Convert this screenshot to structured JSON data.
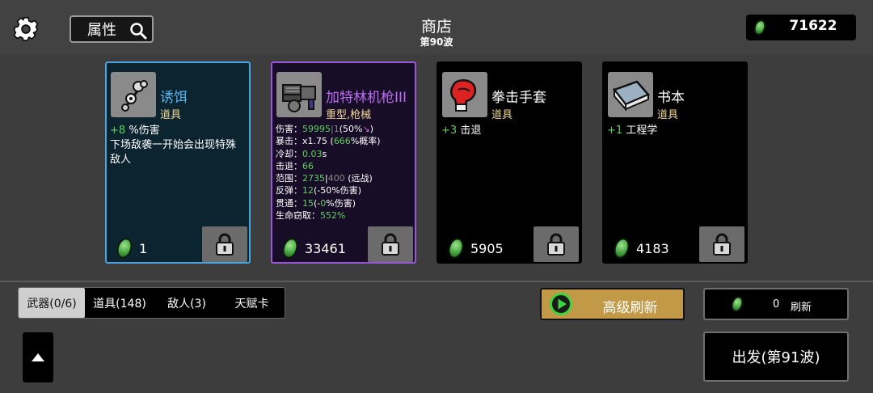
{
  "header": {
    "attr_button": "属性",
    "title": "商店",
    "wave": "第90波",
    "money": "71622"
  },
  "cards": [
    {
      "name": "诱饵",
      "type": "道具",
      "effect_value": "+8",
      "effect_text": "%伤害",
      "desc": "下场敌袭一开始会出现特殊敌人",
      "price": "1",
      "border": "#49a4de"
    },
    {
      "name": "加特林机枪III",
      "type": "重型,枪械",
      "stats": {
        "dmg_label": "伤害：",
        "dmg_value": "59995",
        "dmg_bar": "|",
        "dmg_base": "1",
        "dmg_open": "(50%",
        "dmg_close": ")",
        "crit_label": "暴击：",
        "crit_mult": "x1.75",
        "crit_open": "(",
        "crit_pct": "666",
        "crit_tail": "%概率)",
        "cd_label": "冷却：",
        "cd_value": "0.03",
        "cd_unit": "s",
        "kb_label": "击退：",
        "kb_value": "66",
        "range_label": "范围：",
        "range_value": "2735",
        "range_bar": "|",
        "range_base": "400",
        "range_tail": "(远战)",
        "bounce_label": "反弹：",
        "bounce_value": "12",
        "bounce_tail": "(-50%伤害)",
        "pierce_label": "贯通：",
        "pierce_value": "15",
        "pierce_open": "(-",
        "pierce_pct": "0",
        "pierce_tail": "%伤害)",
        "steal_label": "生命窃取：",
        "steal_value": "552%"
      },
      "price": "33461",
      "border": "#9c57d8"
    },
    {
      "name": "拳击手套",
      "type": "道具",
      "effect_value": "+3",
      "effect_text": "击退",
      "price": "5905"
    },
    {
      "name": "书本",
      "type": "道具",
      "effect_value": "+1",
      "effect_text": "工程学",
      "price": "4183"
    }
  ],
  "tabs": [
    {
      "label": "武器(0/6)",
      "active": true
    },
    {
      "label": "道具(148)",
      "active": false
    },
    {
      "label": "敌人(3)",
      "active": false
    },
    {
      "label": "天赋卡",
      "active": false
    }
  ],
  "buttons": {
    "advanced_refresh": "高级刷新",
    "refresh_cost": "0",
    "refresh": "刷新",
    "depart": "出发(第91波)"
  },
  "colors": {
    "accent_gold": "#c29a47",
    "stat_green": "#5ed05e",
    "item_type_gold": "#f0d896",
    "rare_blue": "#49a4de",
    "epic_purple": "#9c57d8"
  },
  "icons": [
    "gear-icon",
    "search-icon",
    "coin-icon",
    "bait-icon",
    "gatling-gun-icon",
    "boxing-glove-icon",
    "book-icon",
    "lock-icon",
    "play-icon",
    "up-arrow-icon"
  ]
}
